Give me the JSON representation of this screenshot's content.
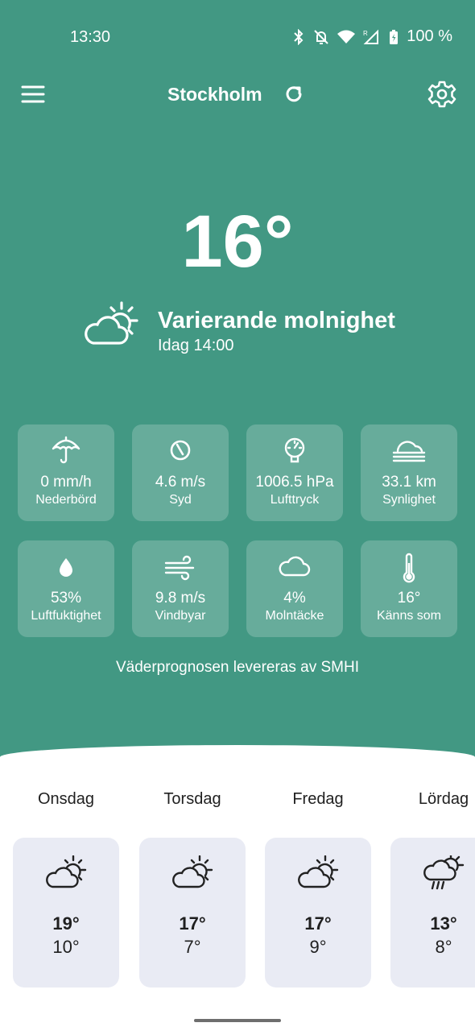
{
  "status_bar": {
    "time": "13:30",
    "battery": "100 %"
  },
  "header": {
    "city": "Stockholm"
  },
  "current": {
    "temperature": "16°",
    "condition": "Varierande molnighet",
    "updated": "Idag 14:00"
  },
  "details": [
    {
      "icon": "umbrella-icon",
      "value": "0 mm/h",
      "label": "Nederbörd"
    },
    {
      "icon": "wind-direction-icon",
      "value": "4.6 m/s",
      "label": "Syd"
    },
    {
      "icon": "pressure-gauge-icon",
      "value": "1006.5 hPa",
      "label": "Lufttryck"
    },
    {
      "icon": "visibility-fog-icon",
      "value": "33.1 km",
      "label": "Synlighet"
    },
    {
      "icon": "water-drop-icon",
      "value": "53%",
      "label": "Luftfuktighet"
    },
    {
      "icon": "wind-gust-icon",
      "value": "9.8 m/s",
      "label": "Vindbyar"
    },
    {
      "icon": "cloud-icon",
      "value": "4%",
      "label": "Molntäcke"
    },
    {
      "icon": "thermometer-icon",
      "value": "16°",
      "label": "Känns som"
    }
  ],
  "provider_text": "Väderprognosen levereras av SMHI",
  "forecast": [
    {
      "day": "Onsdag",
      "icon": "partly-cloudy-icon",
      "high": "19°",
      "low": "10°"
    },
    {
      "day": "Torsdag",
      "icon": "partly-cloudy-icon",
      "high": "17°",
      "low": "7°"
    },
    {
      "day": "Fredag",
      "icon": "partly-cloudy-icon",
      "high": "17°",
      "low": "9°"
    },
    {
      "day": "Lördag",
      "icon": "rain-showers-icon",
      "high": "13°",
      "low": "8°"
    }
  ],
  "colors": {
    "background": "#429883",
    "card": "#e9ebf4",
    "text_light": "#ffffff"
  }
}
